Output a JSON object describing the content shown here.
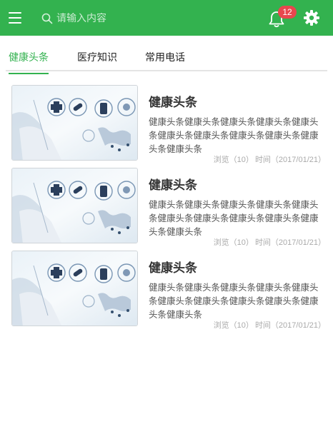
{
  "header": {
    "search_placeholder": "请输入内容",
    "notification_count": "12",
    "accent_color": "#33b24f",
    "badge_color": "#e8474e",
    "icons": [
      "menu-icon",
      "search-icon",
      "bell-icon",
      "gear-icon"
    ]
  },
  "tabs": [
    {
      "label": "健康头条",
      "active": true
    },
    {
      "label": "医疗知识",
      "active": false
    },
    {
      "label": "常用电话",
      "active": false
    }
  ],
  "articles": [
    {
      "title": "健康头条",
      "description": "健康头条健康头条健康头条健康头条健康头条健康头条健康头条健康头条健康头条健康头条健康头条",
      "views_label": "浏览（10）",
      "time_label": "时间（2017/01/21）"
    },
    {
      "title": "健康头条",
      "description": "健康头条健康头条健康头条健康头条健康头条健康头条健康头条健康头条健康头条健康头条健康头条",
      "views_label": "浏览（10）",
      "time_label": "时间（2017/01/21）"
    },
    {
      "title": "健康头条",
      "description": "健康头条健康头条健康头条健康头条健康头条健康头条健康头条健康头条健康头条健康头条健康头条",
      "views_label": "浏览（10）",
      "time_label": "时间（2017/01/21）"
    }
  ]
}
